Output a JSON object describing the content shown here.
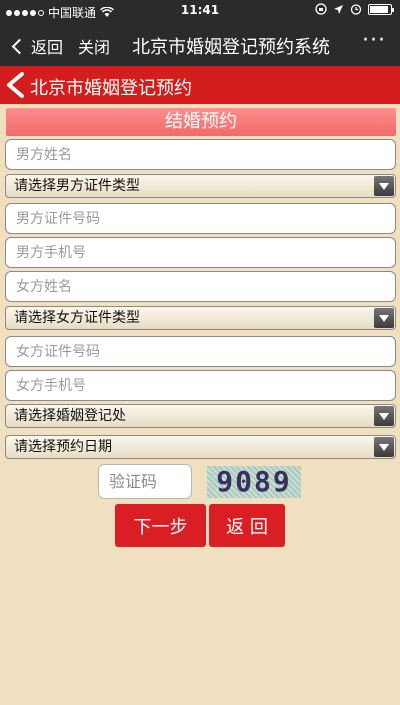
{
  "status": {
    "carrier": "中国联通",
    "time": "11:41"
  },
  "nav": {
    "back_label": "返回",
    "close_label": "关闭",
    "title": "北京市婚姻登记预约系统",
    "more_label": "···"
  },
  "header": {
    "title": "北京市婚姻登记预约"
  },
  "section": {
    "title": "结婚预约"
  },
  "form": {
    "male_name": "男方姓名",
    "male_id_type": "请选择男方证件类型",
    "male_id_number": "男方证件号码",
    "male_phone": "男方手机号",
    "female_name": "女方姓名",
    "female_id_type": "请选择女方证件类型",
    "female_id_number": "女方证件号码",
    "female_phone": "女方手机号",
    "registry_office": "请选择婚姻登记处",
    "appointment_date": "请选择预约日期",
    "captcha_placeholder": "验证码",
    "captcha_text": "9089"
  },
  "buttons": {
    "next": "下一步",
    "back": "返 回"
  },
  "colors": {
    "accent_red": "#d41e1e",
    "banner_pink": "#f26a6a",
    "background": "#f0e0c0"
  }
}
